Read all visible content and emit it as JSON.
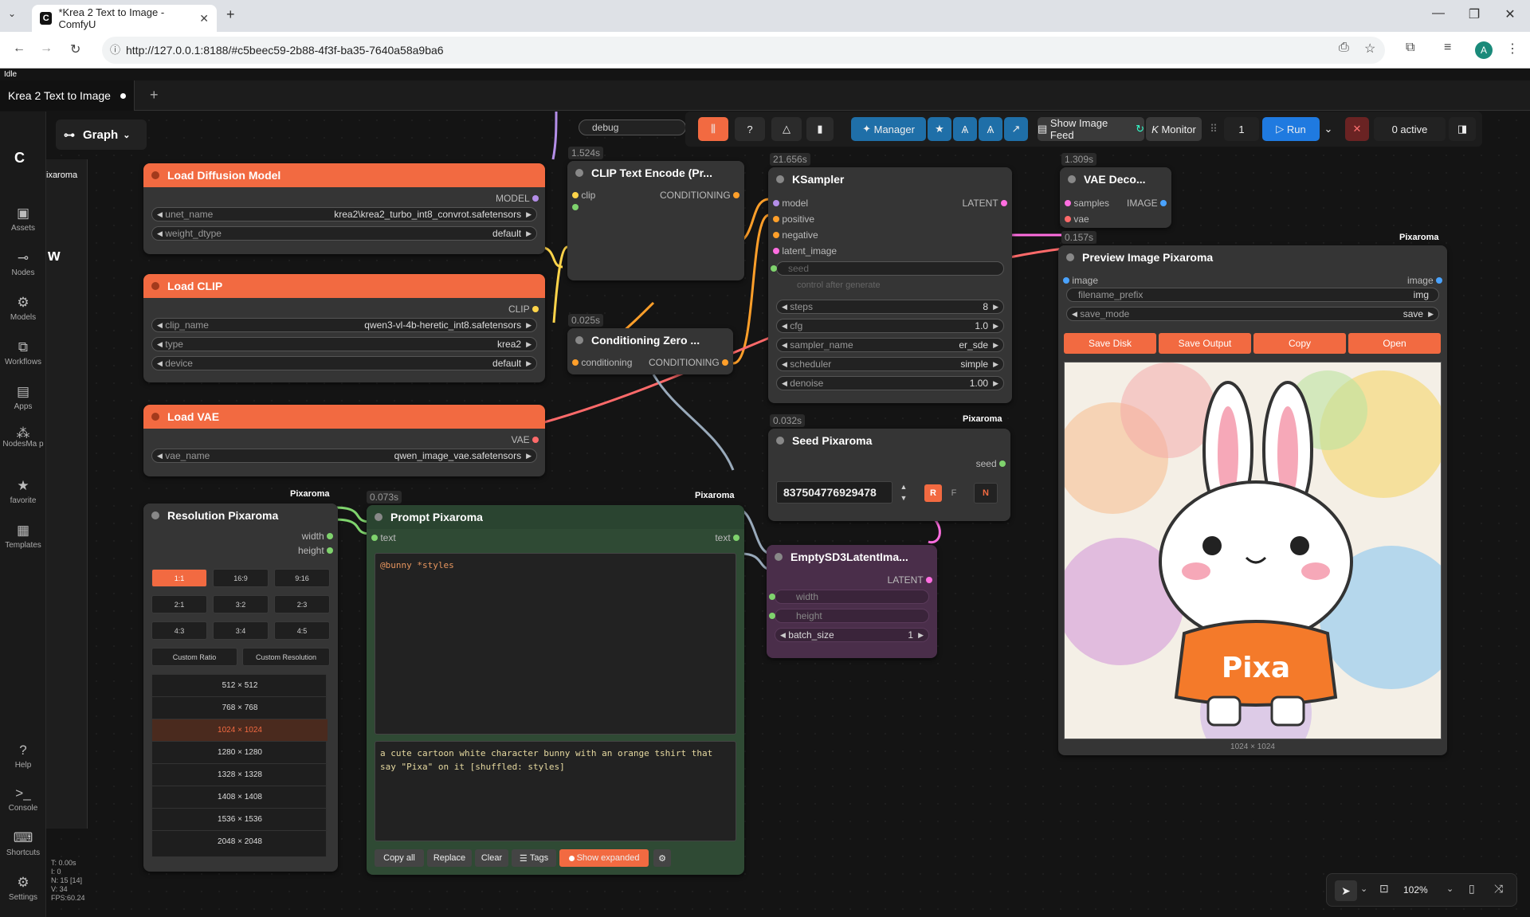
{
  "browser": {
    "tab_title": "*Krea 2 Text to Image - ComfyU",
    "url": "http://127.0.0.1:8188/#c5beec59-2b88-4f3f-ba35-7640a58a9ba6",
    "avatar": "A"
  },
  "app": {
    "status": "Idle",
    "workflow_tab": "Krea 2 Text to Image",
    "graph_label": "Graph",
    "stats": [
      "T: 0.00s",
      "I: 0",
      "N: 15 [14]",
      "V: 34",
      "FPS:60.24"
    ]
  },
  "sidebar": {
    "items": [
      {
        "label": "Assets",
        "icon": "assets-icon"
      },
      {
        "label": "Nodes",
        "icon": "nodes-icon"
      },
      {
        "label": "Models",
        "icon": "models-icon"
      },
      {
        "label": "Workflows",
        "icon": "workflows-icon"
      },
      {
        "label": "Apps",
        "icon": "apps-icon"
      },
      {
        "label": "NodesMa p",
        "icon": "nodesmap-icon"
      },
      {
        "label": "favorite",
        "icon": "star-icon"
      },
      {
        "label": "Templates",
        "icon": "templates-icon"
      }
    ],
    "bottom": [
      {
        "label": "Help",
        "icon": "help-icon"
      },
      {
        "label": "Console",
        "icon": "console-icon"
      },
      {
        "label": "Shortcuts",
        "icon": "keyboard-icon"
      },
      {
        "label": "Settings",
        "icon": "gear-icon"
      }
    ]
  },
  "toolbar": {
    "manager": "Manager",
    "show_feed": "Show Image Feed",
    "monitor": "Monitor",
    "batch": "1",
    "run": "Run",
    "active": "0 active"
  },
  "nodes": {
    "load_diffusion": {
      "title": "Load Diffusion Model",
      "output": "MODEL",
      "unet_name_label": "unet_name",
      "unet_name": "krea2\\krea2_turbo_int8_convrot.safetensors",
      "weight_dtype_label": "weight_dtype",
      "weight_dtype": "default"
    },
    "load_clip": {
      "title": "Load CLIP",
      "output": "CLIP",
      "clip_name_label": "clip_name",
      "clip_name": "qwen3-vl-4b-heretic_int8.safetensors",
      "type_label": "type",
      "type": "krea2",
      "device_label": "device",
      "device": "default"
    },
    "load_vae": {
      "title": "Load VAE",
      "output": "VAE",
      "vae_name_label": "vae_name",
      "vae_name": "qwen_image_vae.safetensors"
    },
    "clip_encode": {
      "title": "CLIP Text Encode (Pr...",
      "timer": "1.524s",
      "input": "clip",
      "output": "CONDITIONING"
    },
    "cond_zero": {
      "title": "Conditioning Zero ...",
      "timer": "0.025s",
      "input": "conditioning",
      "output": "CONDITIONING"
    },
    "debug": {
      "label": "debug"
    },
    "ksampler": {
      "title": "KSampler",
      "timer": "21.656s",
      "output": "LATENT",
      "inputs": [
        "model",
        "positive",
        "negative",
        "latent_image",
        "seed"
      ],
      "control_after": "control after generate",
      "widgets": [
        {
          "name": "steps",
          "value": "8"
        },
        {
          "name": "cfg",
          "value": "1.0"
        },
        {
          "name": "sampler_name",
          "value": "er_sde"
        },
        {
          "name": "scheduler",
          "value": "simple"
        },
        {
          "name": "denoise",
          "value": "1.00"
        }
      ]
    },
    "vae_decode": {
      "title": "VAE Deco...",
      "timer": "1.309s",
      "in1": "samples",
      "in2": "vae",
      "output": "IMAGE"
    },
    "preview": {
      "title": "Preview Image Pixaroma",
      "timer": "0.157s",
      "badge": "Pixaroma",
      "input": "image",
      "output": "image",
      "filename_prefix_label": "filename_prefix",
      "filename_prefix": "img",
      "save_mode_label": "save_mode",
      "save_mode": "save",
      "buttons": [
        "Save Disk",
        "Save Output",
        "Copy",
        "Open"
      ],
      "dims": "1024 × 1024",
      "shirt_text": "Pixa"
    },
    "seed": {
      "title": "Seed Pixaroma",
      "timer": "0.032s",
      "badge": "Pixaroma",
      "output": "seed",
      "value": "837504776929478",
      "r": "R",
      "f": "F",
      "n": "N"
    },
    "empty_latent": {
      "title": "EmptySD3LatentIma...",
      "output": "LATENT",
      "width": "width",
      "height": "height",
      "batch_label": "batch_size",
      "batch": "1"
    },
    "resolution": {
      "title": "Resolution Pixaroma",
      "badge": "Pixaroma",
      "out1": "width",
      "out2": "height",
      "ratios": [
        "1:1",
        "16:9",
        "9:16",
        "2:1",
        "3:2",
        "2:3",
        "4:3",
        "3:4",
        "4:5"
      ],
      "custom": [
        "Custom Ratio",
        "Custom Resolution"
      ],
      "sizes": [
        "512 × 512",
        "768 × 768",
        "1024 × 1024",
        "1280 × 1280",
        "1328 × 1328",
        "1408 × 1408",
        "1536 × 1536",
        "2048 × 2048"
      ]
    },
    "prompt": {
      "title": "Prompt Pixaroma",
      "timer": "0.073s",
      "badge": "Pixaroma",
      "input": "text",
      "output": "text",
      "template": "@bunny *styles",
      "expanded": "a cute cartoon white character bunny with an orange tshirt that say \"Pixa\" on it [shuffled: styles]",
      "buttons": [
        "Copy all",
        "Replace",
        "Clear",
        "Tags",
        "Show expanded"
      ]
    }
  },
  "bottom_bar": {
    "zoom": "102%"
  },
  "partial_labels": {
    "left_pixaroma": "ixaroma",
    "left_w": "w"
  }
}
